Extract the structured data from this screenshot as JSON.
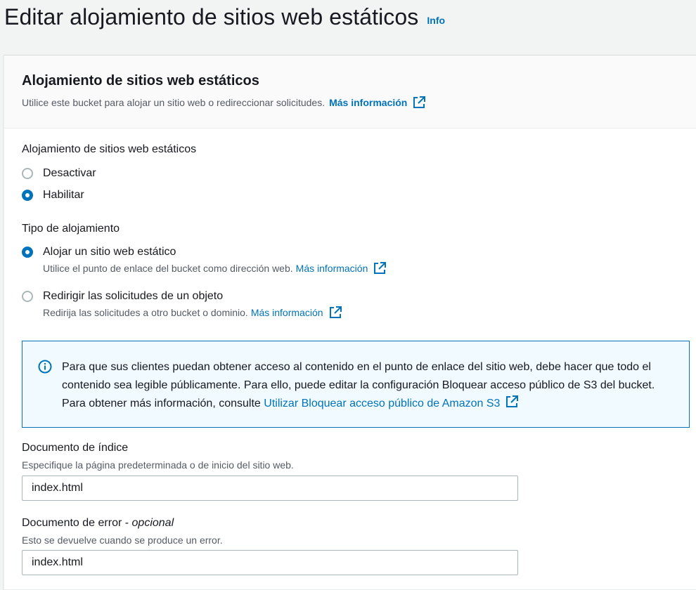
{
  "page": {
    "title": "Editar alojamiento de sitios web estáticos",
    "info_label": "Info"
  },
  "panel": {
    "title": "Alojamiento de sitios web estáticos",
    "description": "Utilice este bucket para alojar un sitio web o redireccionar solicitudes.",
    "more_info_label": "Más información"
  },
  "hosting": {
    "label": "Alojamiento de sitios web estáticos",
    "options": [
      {
        "label": "Desactivar",
        "selected": false
      },
      {
        "label": "Habilitar",
        "selected": true
      }
    ]
  },
  "hosting_type": {
    "label": "Tipo de alojamiento",
    "options": [
      {
        "label": "Alojar un sitio web estático",
        "description": "Utilice el punto de enlace del bucket como dirección web.",
        "link": "Más información",
        "selected": true
      },
      {
        "label": "Redirigir las solicitudes de un objeto",
        "description": "Redirija las solicitudes a otro bucket o dominio.",
        "link": "Más información",
        "selected": false
      }
    ]
  },
  "alert": {
    "text": "Para que sus clientes puedan obtener acceso al contenido en el punto de enlace del sitio web, debe hacer que todo el contenido sea legible públicamente. Para ello, puede editar la configuración Bloquear acceso público de S3 del bucket. Para obtener más información, consulte",
    "link": "Utilizar Bloquear acceso público de Amazon S3"
  },
  "index_document": {
    "label": "Documento de índice",
    "hint": "Especifique la página predeterminada o de inicio del sitio web.",
    "value": "index.html"
  },
  "error_document": {
    "label": "Documento de error - ",
    "optional": "opcional",
    "hint": "Esto se devuelve cuando se produce un error.",
    "value": "index.html"
  },
  "colors": {
    "link": "#0073bb",
    "alert_bg": "#f1faff",
    "page_bg": "#f2f3f3"
  }
}
